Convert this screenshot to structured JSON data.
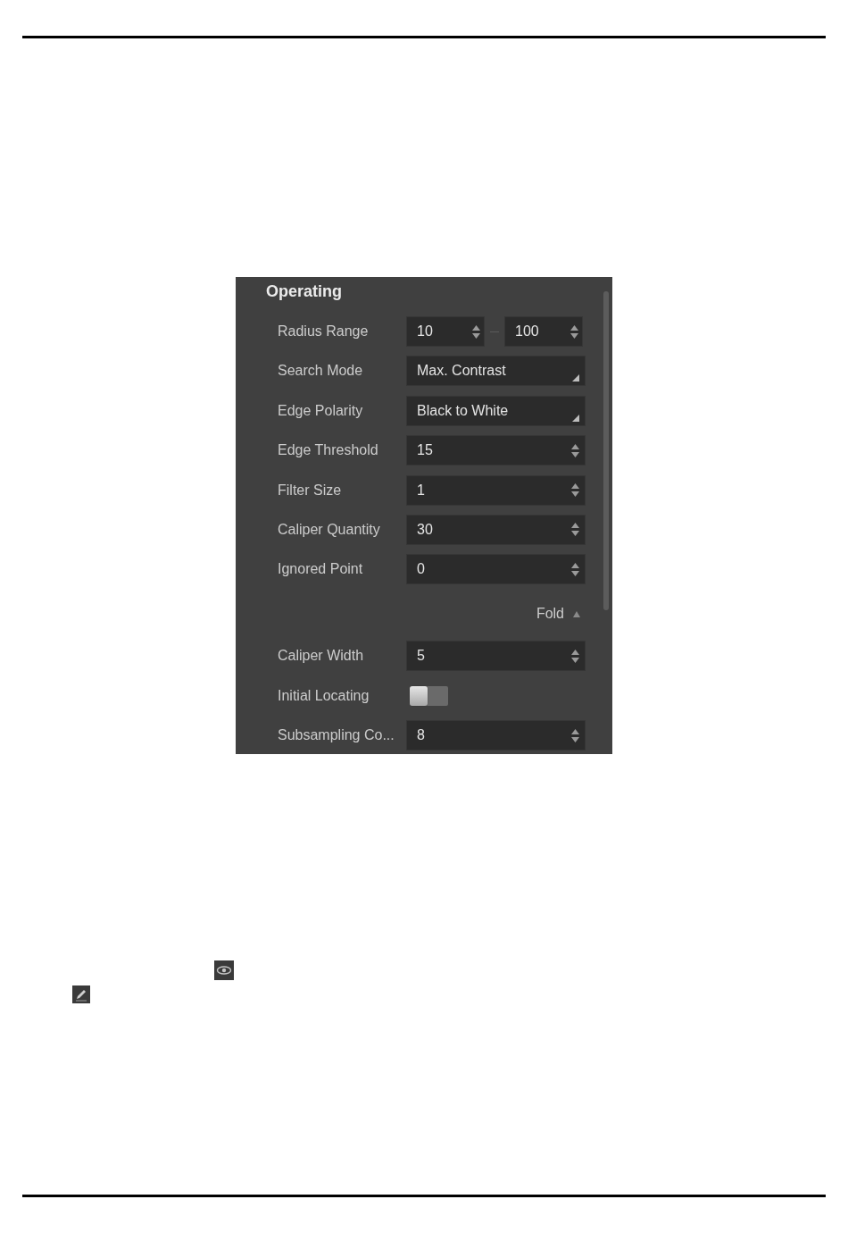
{
  "panel": {
    "title": "Operating",
    "fields": [
      {
        "kind": "range",
        "label": "Radius Range",
        "values": [
          "10",
          "100"
        ]
      },
      {
        "kind": "dropdown",
        "label": "Search Mode",
        "value": "Max. Contrast"
      },
      {
        "kind": "dropdown",
        "label": "Edge Polarity",
        "value": "Black to White"
      },
      {
        "kind": "spin",
        "label": "Edge Threshold",
        "value": "15"
      },
      {
        "kind": "spin",
        "label": "Filter Size",
        "value": "1"
      },
      {
        "kind": "spin",
        "label": "Caliper Quantity",
        "value": "30"
      },
      {
        "kind": "spin",
        "label": "Ignored Point",
        "value": "0"
      }
    ],
    "fold_button": {
      "label": "Fold",
      "expanded": true
    },
    "advanced_fields": [
      {
        "kind": "spin",
        "label": "Caliper Width",
        "value": "5"
      },
      {
        "kind": "toggle",
        "label": "Initial Locating",
        "on": false
      },
      {
        "kind": "spin",
        "label": "Subsampling Co...",
        "value": "8"
      }
    ]
  }
}
